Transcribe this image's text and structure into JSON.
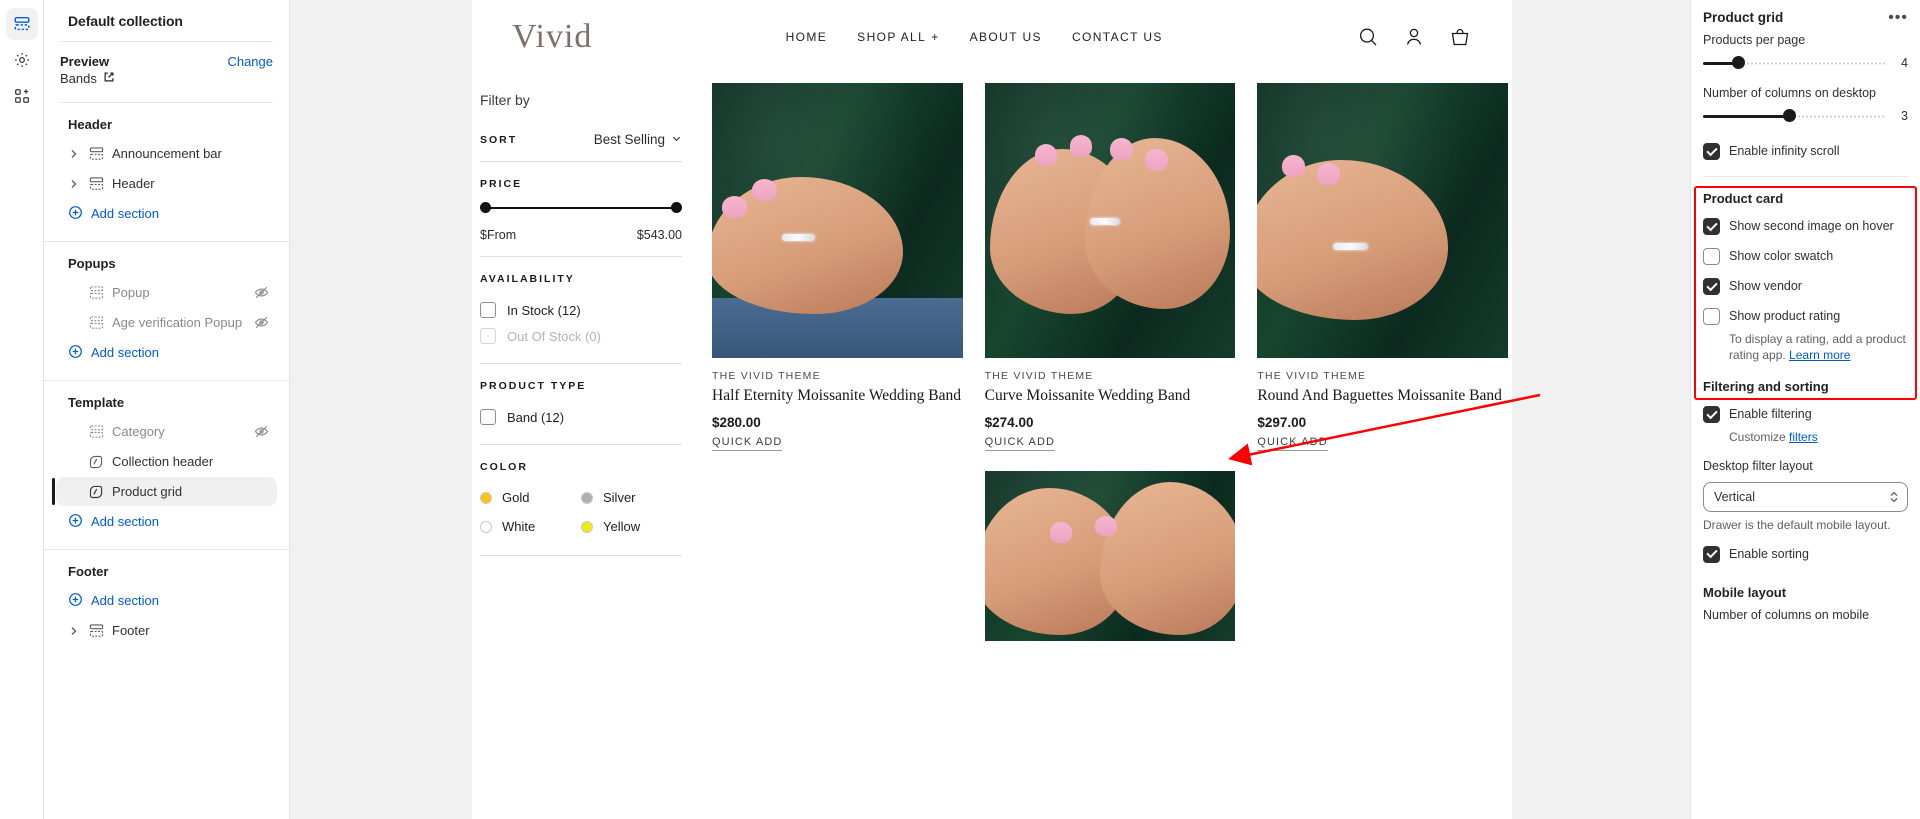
{
  "rail": {
    "items": [
      {
        "name": "sections-icon",
        "active": true
      },
      {
        "name": "settings-gear-icon",
        "active": false
      },
      {
        "name": "apps-add-icon",
        "active": false
      }
    ]
  },
  "sidebar": {
    "title": "Default collection",
    "preview": {
      "label": "Preview",
      "change_label": "Change",
      "value": "Bands"
    },
    "groups": [
      {
        "label": "Header",
        "items": [
          {
            "label": "Announcement bar",
            "icon": "section-icon",
            "expandable": true,
            "hidden": false,
            "selected": false
          },
          {
            "label": "Header",
            "icon": "section-icon",
            "expandable": true,
            "hidden": false,
            "selected": false
          }
        ],
        "add_label": "Add section"
      },
      {
        "label": "Popups",
        "items": [
          {
            "label": "Popup",
            "icon": "section-icon",
            "expandable": false,
            "hidden": true,
            "selected": false
          },
          {
            "label": "Age verification Popup",
            "icon": "section-icon",
            "expandable": false,
            "hidden": true,
            "selected": false
          }
        ],
        "add_label": "Add section"
      },
      {
        "label": "Template",
        "items": [
          {
            "label": "Category",
            "icon": "section-icon",
            "expandable": false,
            "hidden": true,
            "selected": false
          },
          {
            "label": "Collection header",
            "icon": "block-icon",
            "expandable": false,
            "hidden": false,
            "selected": false
          },
          {
            "label": "Product grid",
            "icon": "block-icon",
            "expandable": false,
            "hidden": false,
            "selected": true
          }
        ],
        "add_label": "Add section"
      },
      {
        "label": "Footer",
        "items": [
          {
            "label": "Footer",
            "icon": "section-icon",
            "expandable": true,
            "hidden": false,
            "selected": false
          }
        ],
        "add_label": "Add section"
      }
    ]
  },
  "preview": {
    "brand": "Vivid",
    "nav": [
      {
        "label": "HOME",
        "plus": false
      },
      {
        "label": "SHOP ALL",
        "plus": true
      },
      {
        "label": "ABOUT US",
        "plus": false
      },
      {
        "label": "CONTACT US",
        "plus": false
      }
    ],
    "header_icons": [
      "search-icon",
      "account-icon",
      "cart-icon"
    ],
    "filters": {
      "heading": "Filter by",
      "sort": {
        "title": "SORT",
        "value": "Best Selling"
      },
      "price": {
        "title": "PRICE",
        "min_label": "$From",
        "max_label": "$543.00"
      },
      "availability": {
        "title": "AVAILABILITY",
        "options": [
          {
            "label": "In Stock (12)",
            "checked": false,
            "disabled": false
          },
          {
            "label": "Out Of Stock (0)",
            "checked": false,
            "disabled": true
          }
        ]
      },
      "product_type": {
        "title": "PRODUCT TYPE",
        "options": [
          {
            "label": "Band (12)",
            "checked": false,
            "disabled": false
          }
        ]
      },
      "color": {
        "title": "COLOR",
        "options": [
          {
            "label": "Gold",
            "hex": "#f5c518"
          },
          {
            "label": "Silver",
            "hex": "#b0b0b0"
          },
          {
            "label": "White",
            "hex": "#ffffff"
          },
          {
            "label": "Yellow",
            "hex": "#f2ec0c"
          }
        ]
      }
    },
    "products": [
      {
        "vendor": "THE VIVID THEME",
        "name": "Half Eternity Moissanite Wedding Band",
        "price": "$280.00",
        "quick_add": "QUICK ADD"
      },
      {
        "vendor": "THE VIVID THEME",
        "name": "Curve Moissanite Wedding Band",
        "price": "$274.00",
        "quick_add": "QUICK ADD"
      },
      {
        "vendor": "THE VIVID THEME",
        "name": "Round And Baguettes Moissanite Band",
        "price": "$297.00",
        "quick_add": "QUICK ADD"
      }
    ]
  },
  "inspector": {
    "title": "Product grid",
    "more_label": "•••",
    "products_per_page": {
      "label": "Products per page",
      "value": "4",
      "fill_pct": 19
    },
    "columns_desktop": {
      "label": "Number of columns on desktop",
      "value": "3",
      "fill_pct": 47
    },
    "infinity_scroll": {
      "label": "Enable infinity scroll",
      "checked": true
    },
    "product_card": {
      "title": "Product card",
      "options": [
        {
          "label": "Show second image on hover",
          "checked": true
        },
        {
          "label": "Show color swatch",
          "checked": false
        },
        {
          "label": "Show vendor",
          "checked": true
        },
        {
          "label": "Show product rating",
          "checked": false
        }
      ],
      "rating_help_text": "To display a rating, add a product rating app. ",
      "rating_help_link": "Learn more"
    },
    "filtering": {
      "title": "Filtering and sorting",
      "enable_filtering": {
        "label": "Enable filtering",
        "checked": true
      },
      "customize_prefix": "Customize ",
      "customize_link": "filters",
      "desktop_filter_layout_label": "Desktop filter layout",
      "desktop_filter_layout_value": "Vertical",
      "drawer_hint": "Drawer is the default mobile layout.",
      "enable_sorting": {
        "label": "Enable sorting",
        "checked": true
      }
    },
    "mobile": {
      "title": "Mobile layout",
      "columns_label": "Number of columns on mobile"
    }
  },
  "annotation": {
    "highlight_color": "#ff0000",
    "target": "product-card-section"
  }
}
